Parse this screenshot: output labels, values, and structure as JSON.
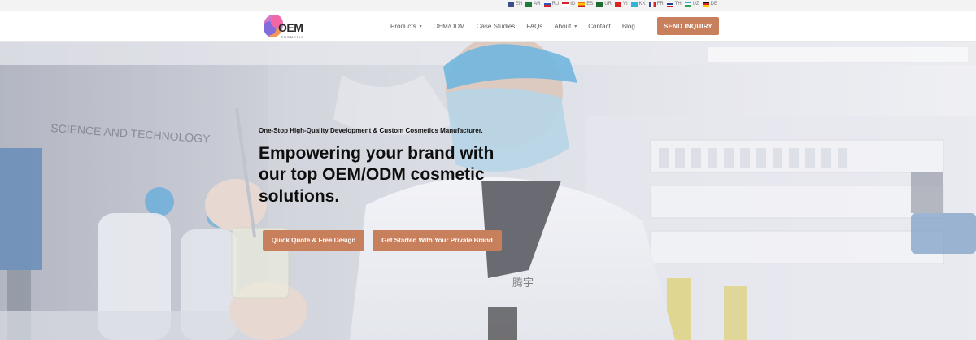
{
  "languages": [
    {
      "code": "EN",
      "flag": "us-flag",
      "color": "#3c4f8a"
    },
    {
      "code": "AR",
      "flag": "sa-flag",
      "color": "#1e7b3a"
    },
    {
      "code": "RU",
      "flag": "ru-flag",
      "color": "#2f58b3"
    },
    {
      "code": "ID",
      "flag": "id-flag",
      "color": "#d2222d"
    },
    {
      "code": "ES",
      "flag": "es-flag",
      "color": "#e0a000"
    },
    {
      "code": "UR",
      "flag": "pk-flag",
      "color": "#1e6b2f"
    },
    {
      "code": "VI",
      "flag": "vn-flag",
      "color": "#d8261e"
    },
    {
      "code": "KK",
      "flag": "kz-flag",
      "color": "#31b4d3"
    },
    {
      "code": "FR",
      "flag": "fr-flag",
      "color": "#2d4aa6"
    },
    {
      "code": "TH",
      "flag": "th-flag",
      "color": "#273f8c"
    },
    {
      "code": "UZ",
      "flag": "uz-flag",
      "color": "#2ea35a"
    },
    {
      "code": "DE",
      "flag": "de-flag",
      "color": "#e0a800"
    }
  ],
  "header": {
    "logo": {
      "main": "OEM",
      "sub": "COSMETIC"
    },
    "nav": [
      {
        "label": "Products",
        "dropdown": true
      },
      {
        "label": "OEM/ODM",
        "dropdown": false
      },
      {
        "label": "Case Studies",
        "dropdown": false
      },
      {
        "label": "FAQs",
        "dropdown": false
      },
      {
        "label": "About",
        "dropdown": true
      },
      {
        "label": "Contact",
        "dropdown": false
      },
      {
        "label": "Blog",
        "dropdown": false
      }
    ],
    "cta": "SEND INQUIRY"
  },
  "hero": {
    "subtitle": "One-Stop High-Quality Development & Custom Cosmetics Manufacturer.",
    "title": "Empowering your brand with our top OEM/ODM cosmetic solutions.",
    "wall_text": "SCIENCE AND TECHNOLOGY",
    "coat_text": "腾宇",
    "buttons": [
      {
        "label": "Quick Quote & Free Design"
      },
      {
        "label": "Get Started With Your Private Brand"
      }
    ]
  },
  "colors": {
    "accent": "#c87f5c",
    "mask": "#a9cfe4",
    "cap": "#4aa6d8"
  }
}
